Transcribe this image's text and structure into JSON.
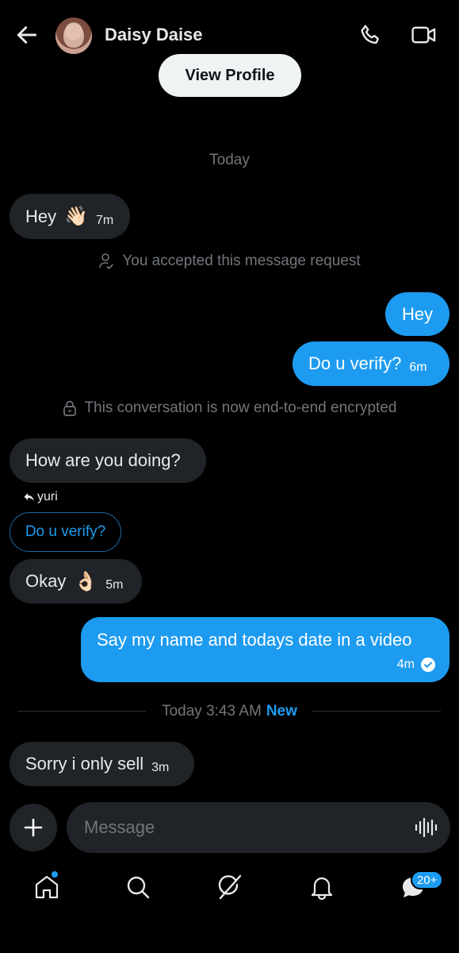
{
  "header": {
    "contact_name": "Daisy Daise",
    "view_profile_label": "View Profile"
  },
  "conversation": {
    "date_separator": "Today",
    "messages": [
      {
        "direction": "in",
        "text": "Hey",
        "emoji": "👋🏻",
        "time": "7m"
      },
      {
        "direction": "system",
        "text": "You accepted this message request",
        "icon": "user-check-icon"
      },
      {
        "direction": "out",
        "text": "Hey"
      },
      {
        "direction": "out",
        "text": "Do u verify?",
        "time": "6m"
      },
      {
        "direction": "system",
        "text": "This conversation is now end-to-end encrypted",
        "icon": "lock-icon"
      },
      {
        "direction": "in",
        "text": "How are you doing?"
      },
      {
        "direction": "in-reply",
        "reply_to": "yuri",
        "quoted": "Do u verify?"
      },
      {
        "direction": "in",
        "text": "Okay",
        "emoji": "👌🏻",
        "time": "5m"
      },
      {
        "direction": "out",
        "text": "Say my name and todays date in a video",
        "time": "4m",
        "status": "read"
      },
      {
        "direction": "in",
        "text": "Sorry i only sell",
        "time": "3m"
      }
    ],
    "new_separator": {
      "label": "Today 3:43 AM",
      "new_label": "New"
    }
  },
  "composer": {
    "placeholder": "Message"
  },
  "nav": {
    "messages_badge": "20+"
  },
  "colors": {
    "accent": "#1d9bf0",
    "incoming_bubble": "#202327",
    "background": "#000000"
  }
}
